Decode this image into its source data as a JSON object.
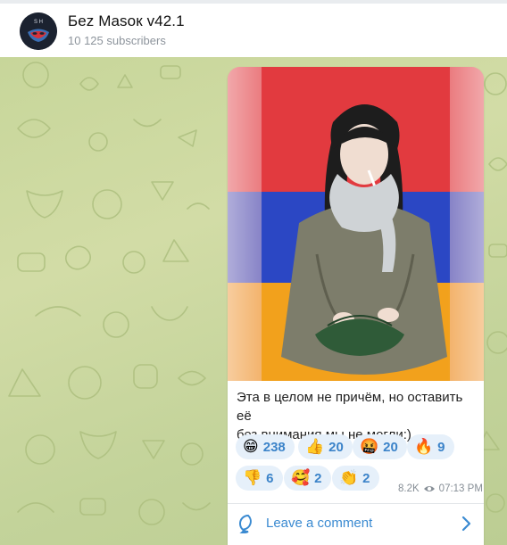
{
  "channel": {
    "title": "Бez Masoк v42.1",
    "subscribers": "10 125 subscribers",
    "avatar_letters": "S H",
    "avatar_icon": "mask-emblem-icon"
  },
  "post": {
    "caption_line1": "Эта в целом не причём, но оставить её",
    "caption_line2": "без внимания мы не могли:)",
    "views": "8.2K",
    "time": "07:13 PM",
    "reactions": [
      {
        "emoji": "😁",
        "count": "238"
      },
      {
        "emoji": "👍",
        "count": "20"
      },
      {
        "emoji": "🤬",
        "count": "20"
      },
      {
        "emoji": "🔥",
        "count": "9"
      },
      {
        "emoji": "👎",
        "count": "6"
      },
      {
        "emoji": "🥰",
        "count": "2"
      },
      {
        "emoji": "👏",
        "count": "2"
      }
    ],
    "comment_label": "Leave a comment"
  },
  "colors": {
    "accent": "#3a8ad1",
    "flag_red": "#e23a3f",
    "flag_blue": "#2b47c4",
    "flag_orange": "#f2a11c",
    "chat_bg": "#c9d79d"
  }
}
